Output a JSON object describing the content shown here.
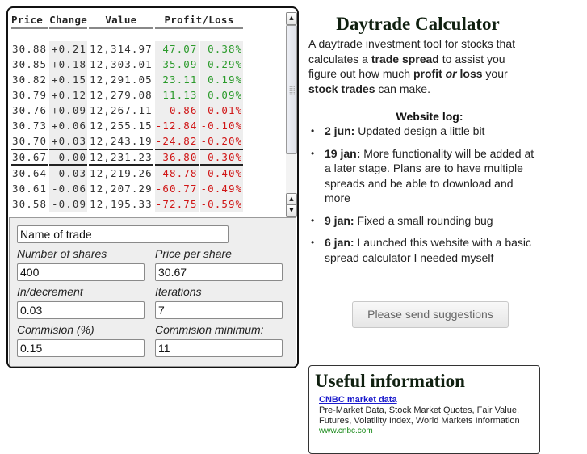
{
  "calculator": {
    "table": {
      "headers": [
        "Price",
        "Change",
        "Value",
        "Profit/Loss"
      ],
      "rows": [
        {
          "price": "30.88",
          "change": "+0.21",
          "value": "12,314.97",
          "profit": "47.07",
          "percent": "0.38%",
          "status": "pos"
        },
        {
          "price": "30.85",
          "change": "+0.18",
          "value": "12,303.01",
          "profit": "35.09",
          "percent": "0.29%",
          "status": "pos"
        },
        {
          "price": "30.82",
          "change": "+0.15",
          "value": "12,291.05",
          "profit": "23.11",
          "percent": "0.19%",
          "status": "pos"
        },
        {
          "price": "30.79",
          "change": "+0.12",
          "value": "12,279.08",
          "profit": "11.13",
          "percent": "0.09%",
          "status": "pos"
        },
        {
          "price": "30.76",
          "change": "+0.09",
          "value": "12,267.11",
          "profit": "-0.86",
          "percent": "-0.01%",
          "status": "neg"
        },
        {
          "price": "30.73",
          "change": "+0.06",
          "value": "12,255.15",
          "profit": "-12.84",
          "percent": "-0.10%",
          "status": "neg"
        },
        {
          "price": "30.70",
          "change": "+0.03",
          "value": "12,243.19",
          "profit": "-24.82",
          "percent": "-0.20%",
          "status": "neg"
        },
        {
          "price": "30.67",
          "change": "0.00",
          "value": "12,231.23",
          "profit": "-36.80",
          "percent": "-0.30%",
          "status": "neg",
          "current": true
        },
        {
          "price": "30.64",
          "change": "-0.03",
          "value": "12,219.26",
          "profit": "-48.78",
          "percent": "-0.40%",
          "status": "neg"
        },
        {
          "price": "30.61",
          "change": "-0.06",
          "value": "12,207.29",
          "profit": "-60.77",
          "percent": "-0.49%",
          "status": "neg"
        },
        {
          "price": "30.58",
          "change": "-0.09",
          "value": "12,195.33",
          "profit": "-72.75",
          "percent": "-0.59%",
          "status": "neg"
        }
      ]
    },
    "scrollbar": {
      "up_icon": "▲",
      "down_icon": "▼"
    },
    "form": {
      "trade_name": {
        "value": "Name of trade"
      },
      "shares": {
        "label": "Number of shares",
        "value": "400"
      },
      "price": {
        "label": "Price per share",
        "value": "30.67"
      },
      "increment": {
        "label": "In/decrement",
        "value": "0.03"
      },
      "iterations": {
        "label": "Iterations",
        "value": "7"
      },
      "commission_pct": {
        "label": "Commision (%)",
        "value": "0.15"
      },
      "commission_min": {
        "label": "Commision minimum:",
        "value": "11"
      }
    }
  },
  "sidebar": {
    "title": "Daytrade Calculator",
    "intro": {
      "p1": "A daytrade investment tool for stocks that calculates a ",
      "b1": "trade spread",
      "p2": " to assist you figure out how much ",
      "b2": "profit",
      "i1": "or",
      "b3": "loss",
      "p3": " your ",
      "b4": "stock trades",
      "p4": " can make."
    },
    "log_title": "Website log:",
    "log": [
      {
        "date": "2 jun:",
        "text": " Updated design a little bit"
      },
      {
        "date": "19 jan:",
        "text": " More functionality will be added at a later stage. Plans are to have multiple spreads and be able to download and more"
      },
      {
        "date": "9 jan:",
        "text": " Fixed a small rounding bug"
      },
      {
        "date": "6 jan:",
        "text": " Launched this website with a basic spread calculator I needed myself"
      }
    ],
    "bullet": "•",
    "suggest_button": "Please send suggestions",
    "useful_info": {
      "title": "Useful information",
      "link_text": "CNBC market data",
      "description": "Pre-Market Data, Stock Market Quotes, Fair Value, Futures, Volatility Index, World Markets Information",
      "url_text": "www.cnbc.com"
    }
  },
  "colors": {
    "positive": "#2a9a2a",
    "negative": "#d01515",
    "link": "#1a1acc",
    "url": "#1a8a1a"
  }
}
